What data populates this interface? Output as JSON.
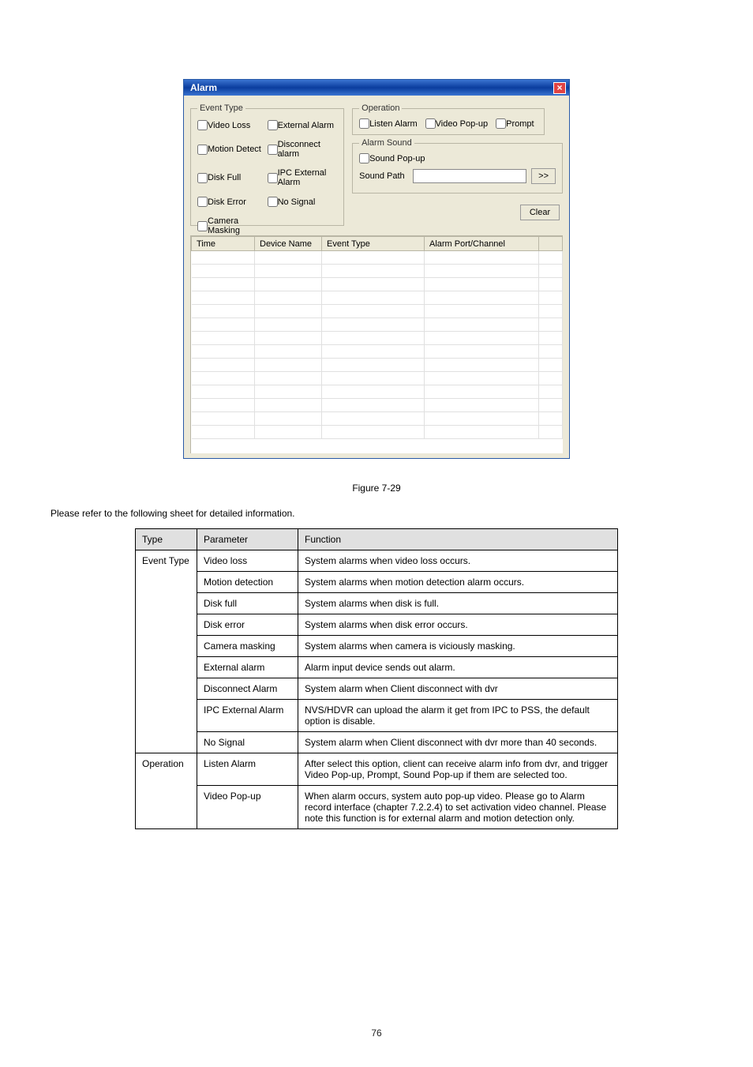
{
  "dialog": {
    "title": "Alarm",
    "close": "×",
    "event_type": {
      "legend": "Event Type",
      "items": {
        "video_loss": "Video Loss",
        "external_alarm": "External Alarm",
        "motion_detect": "Motion Detect",
        "disconnect_alarm": "Disconnect alarm",
        "disk_full": "Disk Full",
        "ipc_external": "IPC External Alarm",
        "disk_error": "Disk Error",
        "no_signal": "No Signal",
        "camera_masking": "Camera Masking"
      }
    },
    "operation": {
      "legend": "Operation",
      "listen_alarm": "Listen Alarm",
      "video_popup": "Video Pop-up",
      "prompt": "Prompt"
    },
    "alarm_sound": {
      "legend": "Alarm Sound",
      "sound_popup": "Sound Pop-up",
      "sound_path_label": "Sound Path",
      "sound_path_value": "",
      "browse": ">>"
    },
    "clear": "Clear",
    "table": {
      "time": "Time",
      "device": "Device Name",
      "event": "Event Type",
      "port": "Alarm Port/Channel"
    }
  },
  "caption": "Figure 7-29",
  "refer_text": "Please refer to the following sheet for detailed information.",
  "info_table": {
    "headers": {
      "type": "Type",
      "param": "Parameter",
      "func": "Function"
    },
    "groups": [
      {
        "type": "Event Type",
        "rows": [
          {
            "param": "Video loss",
            "func": "System alarms when video loss occurs."
          },
          {
            "param": "Motion detection",
            "func": "System alarms when motion detection alarm occurs."
          },
          {
            "param": "Disk full",
            "func": "System alarms when disk is full."
          },
          {
            "param": "Disk error",
            "func": "System alarms when disk error occurs."
          },
          {
            "param": "Camera masking",
            "func": "System alarms when camera is viciously masking."
          },
          {
            "param": "External alarm",
            "func": "Alarm input device sends out alarm."
          },
          {
            "param": "Disconnect Alarm",
            "func": "System alarm when Client disconnect with dvr"
          },
          {
            "param": "IPC External Alarm",
            "func": "NVS/HDVR can upload the alarm it get from IPC to PSS, the default option is disable."
          },
          {
            "param": "No Signal",
            "func": "System alarm when Client disconnect with dvr more than 40 seconds."
          }
        ]
      },
      {
        "type": "Operation",
        "rows": [
          {
            "param": "Listen Alarm",
            "func": "After select this option, client can receive alarm info from dvr, and trigger Video Pop-up, Prompt, Sound Pop-up if them are selected too."
          },
          {
            "param": "Video Pop-up",
            "func": "When alarm occurs, system auto pop-up video. Please go to Alarm record interface (chapter 7.2.2.4) to set activation video channel. Please note this function is for external alarm and motion detection only."
          }
        ]
      }
    ]
  },
  "footer": "76"
}
